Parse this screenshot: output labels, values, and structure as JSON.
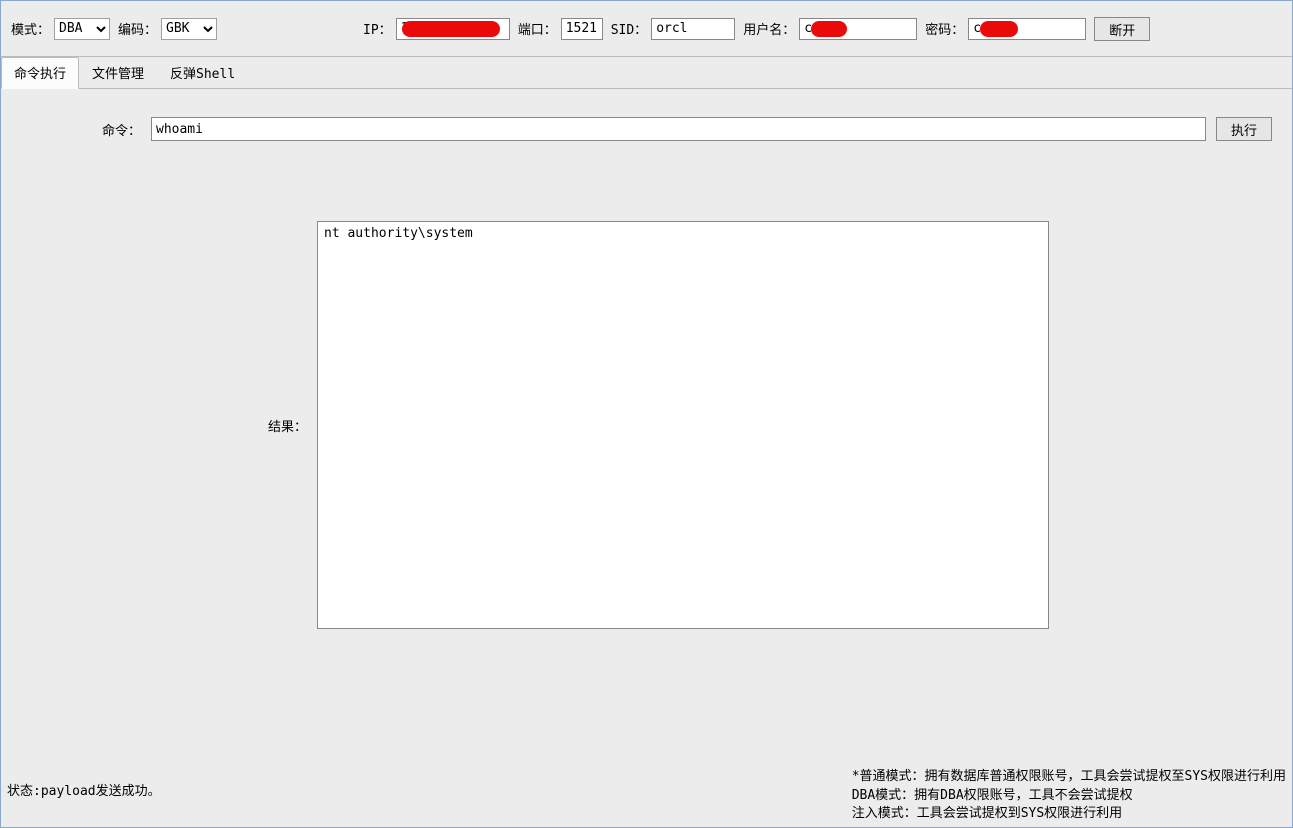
{
  "toolbar": {
    "mode_label": "模式：",
    "mode_value": "DBA",
    "encoding_label": "编码：",
    "encoding_value": "GBK",
    "ip_label": "IP：",
    "ip_value": "1             3",
    "port_label": "端口：",
    "port_value": "1521",
    "sid_label": "SID：",
    "sid_value": "orcl",
    "username_label": "用户名：",
    "username_value": "c",
    "password_label": "密码：",
    "password_value": "c",
    "disconnect_label": "断开"
  },
  "tabs": {
    "cmd": "命令执行",
    "file": "文件管理",
    "shell": "反弹Shell"
  },
  "cmd": {
    "label": "命令：",
    "value": "whoami",
    "execute_label": "执行"
  },
  "result": {
    "label": "结果：",
    "output": "nt authority\\system\n"
  },
  "footer": {
    "status": "状态:payload发送成功。",
    "help_line1": "*普通模式：拥有数据库普通权限账号，工具会尝试提权至SYS权限进行利用",
    "help_line2": " DBA模式：拥有DBA权限账号，工具不会尝试提权",
    "help_line3": " 注入模式：工具会尝试提权到SYS权限进行利用"
  }
}
